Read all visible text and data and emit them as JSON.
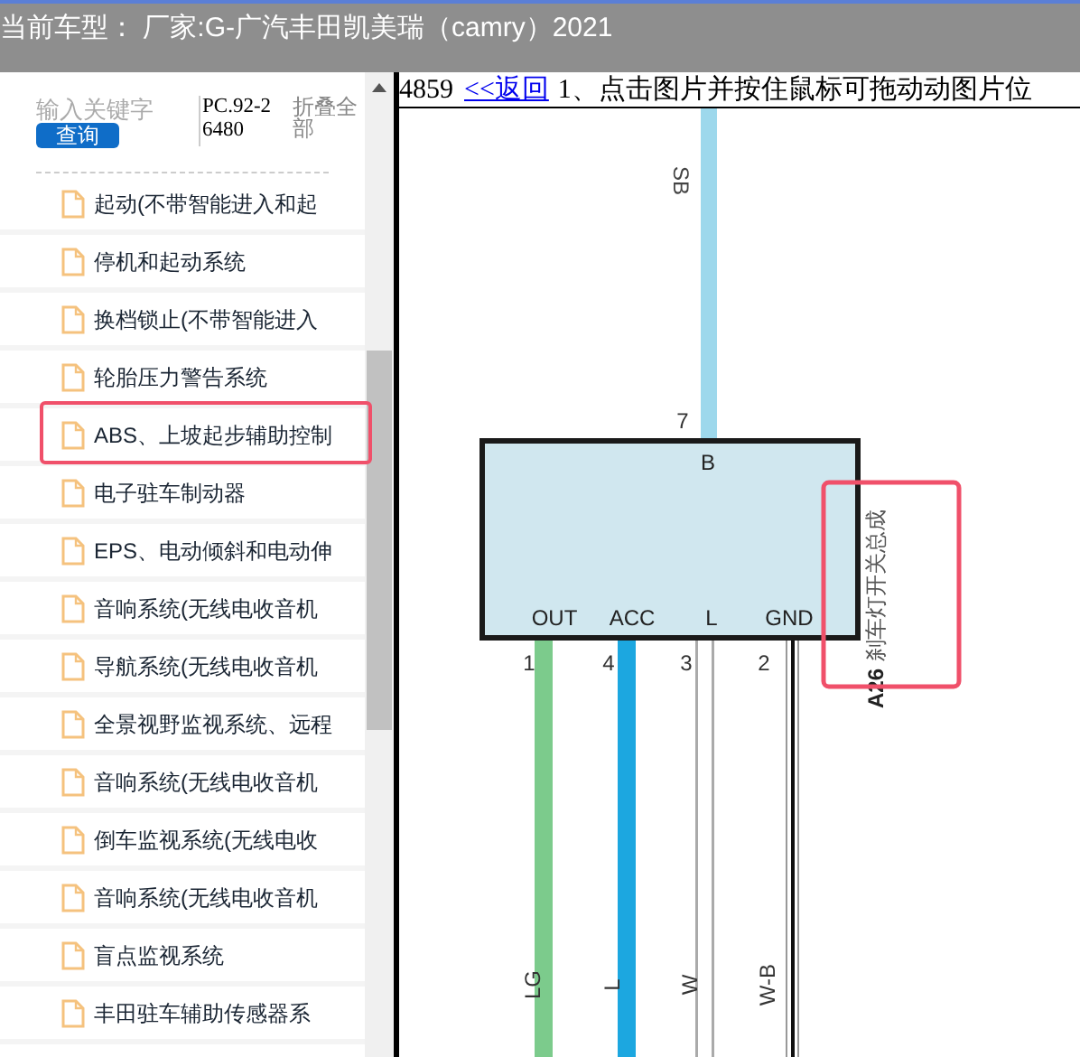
{
  "header": {
    "title": "当前车型： 厂家:G-广汽丰田凯美瑞（camry）2021"
  },
  "sidebar": {
    "search": {
      "placeholder": "输入关键字"
    },
    "query_button": "查询",
    "code": "PC.92-26480",
    "collapse_all": "折叠全部",
    "items": [
      {
        "label": "起动(不带智能进入和起",
        "highlighted": false
      },
      {
        "label": "停机和起动系统",
        "highlighted": false
      },
      {
        "label": "换档锁止(不带智能进入",
        "highlighted": false
      },
      {
        "label": "轮胎压力警告系统",
        "highlighted": false
      },
      {
        "label": "ABS、上坡起步辅助控制",
        "highlighted": true
      },
      {
        "label": "电子驻车制动器",
        "highlighted": false
      },
      {
        "label": "EPS、电动倾斜和电动伸",
        "highlighted": false
      },
      {
        "label": "音响系统(无线电收音机",
        "highlighted": false
      },
      {
        "label": "导航系统(无线电收音机",
        "highlighted": false
      },
      {
        "label": "全景视野监视系统、远程",
        "highlighted": false
      },
      {
        "label": "音响系统(无线电收音机",
        "highlighted": false
      },
      {
        "label": "倒车监视系统(无线电收",
        "highlighted": false
      },
      {
        "label": "音响系统(无线电收音机",
        "highlighted": false
      },
      {
        "label": "盲点监视系统",
        "highlighted": false
      },
      {
        "label": "丰田驻车辅助传感器系",
        "highlighted": false
      }
    ]
  },
  "main": {
    "page_number": "4859",
    "back_link": "<<返回",
    "hint": "1、点击图片并按住鼠标可拖动动图片位",
    "diagram": {
      "top_wire": {
        "label": "SB",
        "pin": "7",
        "color": "#9dd8ec"
      },
      "connector_label": "B",
      "component": {
        "code": "A26",
        "name": "刹车灯开关总成",
        "highlighted": true
      },
      "pins": [
        {
          "name": "OUT",
          "number": "1",
          "wire": "LG",
          "kind": "thick",
          "color": "#7ccb8c"
        },
        {
          "name": "ACC",
          "number": "4",
          "wire": "L",
          "kind": "thick",
          "color": "#1ca7e0"
        },
        {
          "name": "L",
          "number": "3",
          "wire": "W",
          "kind": "double",
          "color": "#aaaaaa"
        },
        {
          "name": "GND",
          "number": "2",
          "wire": "W-B",
          "kind": "striped",
          "color": "#111111"
        }
      ]
    }
  }
}
